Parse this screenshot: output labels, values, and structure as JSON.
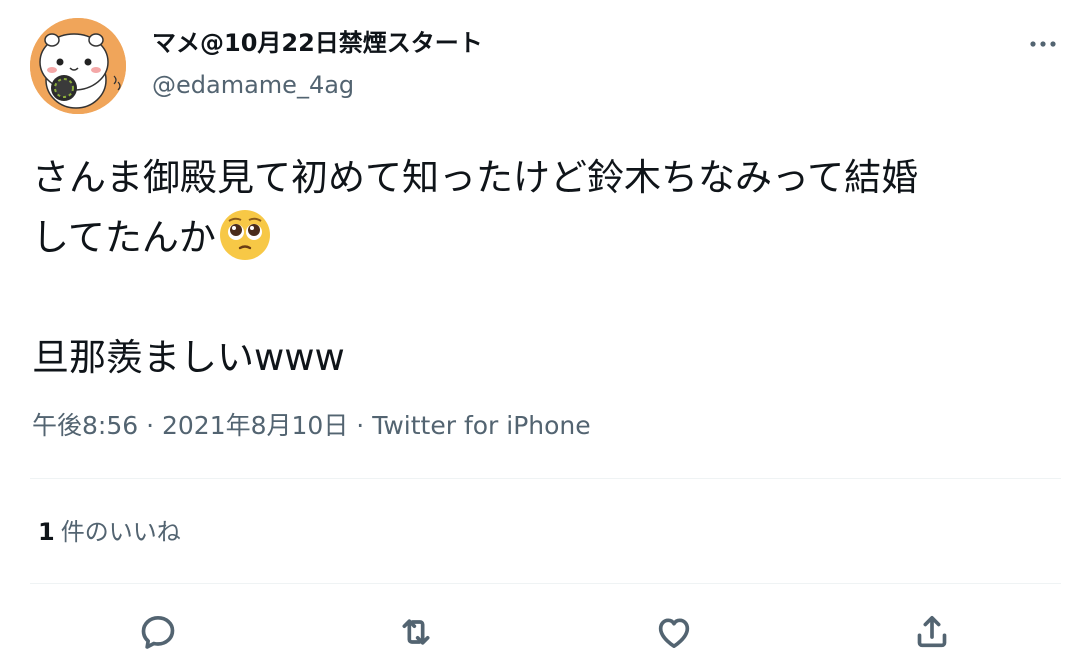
{
  "user": {
    "display_name": "マメ@10月22日禁煙スタート",
    "handle": "@edamame_4ag",
    "avatar_icon": "hamster-avatar-icon"
  },
  "tweet": {
    "line1": "さんま御殿見て初めて知ったけど鈴木ちなみって結婚",
    "line2": "してたんか",
    "emoji": "pleading-face-emoji",
    "paragraph2": "旦那羨ましいwww"
  },
  "meta": {
    "time": "午後8:56",
    "separator": "·",
    "date": "2021年8月10日",
    "source": "Twitter for iPhone"
  },
  "likes": {
    "count": "1",
    "label": "件のいいね"
  },
  "actions": [
    "reply-icon",
    "retweet-icon",
    "like-icon",
    "share-icon"
  ],
  "colors": {
    "text": "#0f1419",
    "secondary": "#536471",
    "divider": "#eff3f4",
    "avatar_bg": "#f0a55a"
  }
}
